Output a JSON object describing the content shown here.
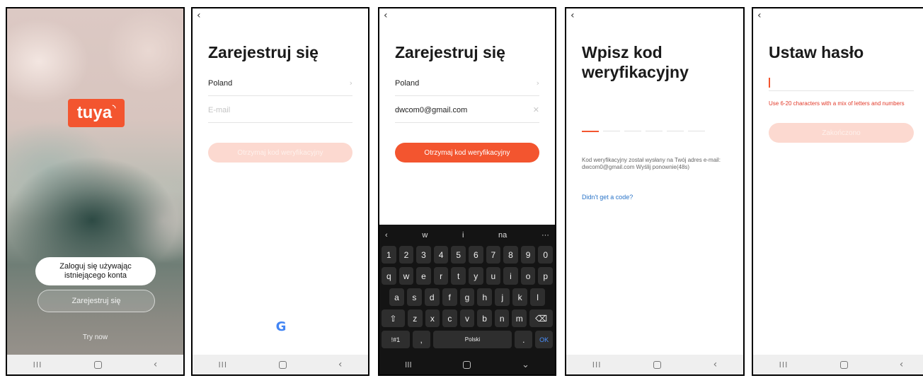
{
  "screen1": {
    "logo_text": "tuya",
    "login_label": "Zaloguj się używając istniejącego konta",
    "register_label": "Zarejestruj się",
    "try_label": "Try now"
  },
  "screen2": {
    "title": "Zarejestruj się",
    "country": "Poland",
    "email_placeholder": "E-mail",
    "button_label": "Otrzymaj kod weryfikacyjny",
    "google_label": "G"
  },
  "screen3": {
    "title": "Zarejestruj się",
    "country": "Poland",
    "email_value": "dwcom0@gmail.com",
    "button_label": "Otrzymaj kod weryfikacyjny",
    "keyboard": {
      "suggestions": [
        "w",
        "i",
        "na",
        "···"
      ],
      "row_numbers": [
        "1",
        "2",
        "3",
        "4",
        "5",
        "6",
        "7",
        "8",
        "9",
        "0"
      ],
      "row_q": [
        "q",
        "w",
        "e",
        "r",
        "t",
        "y",
        "u",
        "i",
        "o",
        "p"
      ],
      "row_a": [
        "a",
        "s",
        "d",
        "f",
        "g",
        "h",
        "j",
        "k",
        "l"
      ],
      "row_z": [
        "z",
        "x",
        "c",
        "v",
        "b",
        "n",
        "m"
      ],
      "symbols_label": "!#1",
      "comma_label": ",",
      "space_label": "Polski",
      "period_label": ".",
      "ok_label": "OK"
    }
  },
  "screen4": {
    "title": "Wpisz kod weryfikacyjny",
    "info_text": "Kod weryfikacyjny został wysłany na Twój adres e-mail: dwcom0@gmail.com  Wyślij ponownie(48s)",
    "link_text": "Didn't get a code?"
  },
  "screen5": {
    "title": "Ustaw hasło",
    "hint_text": "Use 6-20 characters with a mix of letters and numbers",
    "button_label": "Zakończono"
  },
  "nav": {
    "back_arrow": "‹",
    "recent_icon": "III",
    "back_icon": "‹"
  },
  "colors": {
    "accent": "#f3552f",
    "accent_disabled": "#fcd9d0",
    "link": "#2a74c8",
    "error": "#e23a2a"
  }
}
